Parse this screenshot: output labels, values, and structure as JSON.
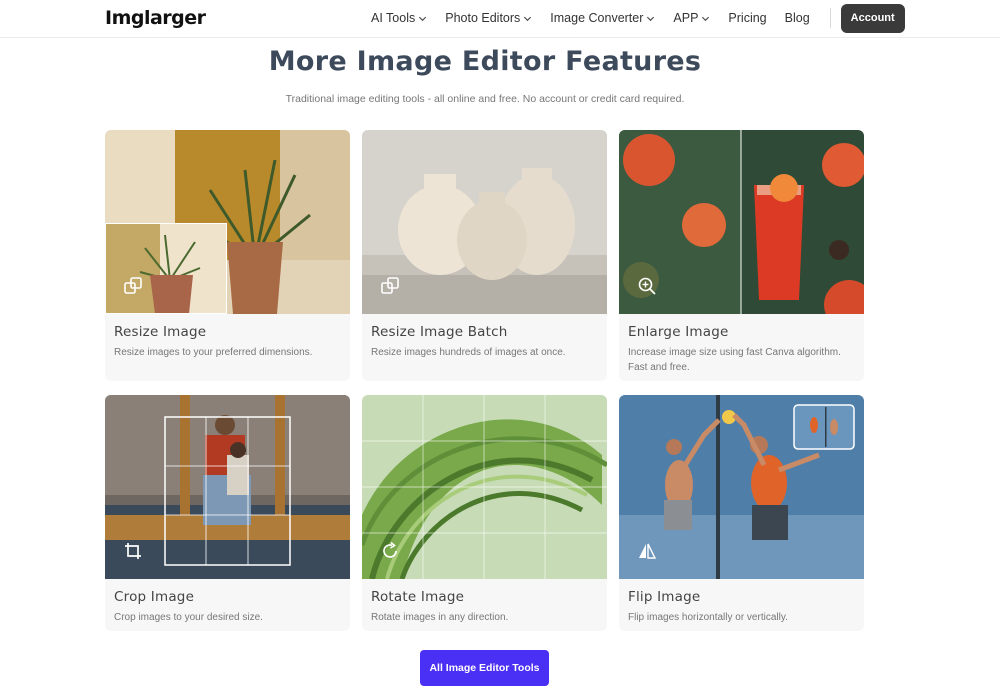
{
  "brand": {
    "logo_text": "Imglarger"
  },
  "nav": {
    "items": [
      {
        "label": "AI Tools",
        "dropdown": true
      },
      {
        "label": "Photo Editors",
        "dropdown": true
      },
      {
        "label": "Image Converter",
        "dropdown": true
      },
      {
        "label": "APP",
        "dropdown": true
      },
      {
        "label": "Pricing",
        "dropdown": false
      },
      {
        "label": "Blog",
        "dropdown": false
      }
    ],
    "account_label": "Account"
  },
  "section": {
    "title": "More Image Editor Features",
    "subtitle": "Traditional image editing tools - all online and free. No account or credit card required."
  },
  "cards": [
    {
      "title": "Resize Image",
      "desc": "Resize images to your preferred dimensions.",
      "icon": "resize-icon"
    },
    {
      "title": "Resize Image Batch",
      "desc": "Resize images hundreds of images at once.",
      "icon": "resize-batch-icon"
    },
    {
      "title": "Enlarge Image",
      "desc": "Increase image size using fast Canva algorithm. Fast and free.",
      "icon": "zoom-in-icon"
    },
    {
      "title": "Crop Image",
      "desc": "Crop images to your desired size.",
      "icon": "crop-icon"
    },
    {
      "title": "Rotate Image",
      "desc": "Rotate images in any direction.",
      "icon": "rotate-icon"
    },
    {
      "title": "Flip Image",
      "desc": "Flip images horizontally or vertically.",
      "icon": "flip-icon"
    }
  ],
  "cta_label": "All Image Editor Tools",
  "colors": {
    "cta": "#4a2ff5",
    "title": "#3d4a5c",
    "account_button": "#3a3a3a"
  }
}
